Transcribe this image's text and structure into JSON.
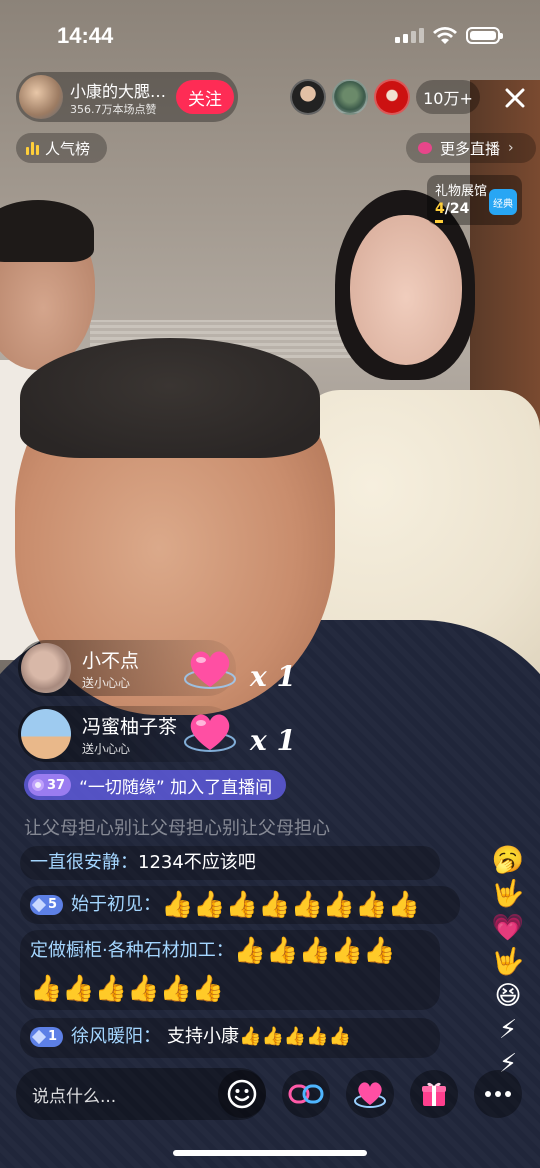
{
  "status_bar": {
    "time": "14:44"
  },
  "anchor": {
    "name": "小康的大腮…",
    "likes": "356.7万本场点赞",
    "follow_label": "关注"
  },
  "viewers": {
    "count_label": "10万+"
  },
  "rank_label": "人气榜",
  "more_live_label": "更多直播",
  "gift_pavilion": {
    "title": "礼物展馆",
    "current": "4",
    "total": "/24",
    "badge": "经典"
  },
  "gift_notifications": [
    {
      "user": "小不点",
      "action": "送小心心",
      "multiplier": "x 1"
    },
    {
      "user": "冯蜜柚子茶",
      "action": "送小心心",
      "multiplier": "x 1"
    }
  ],
  "join_notice": {
    "level": "37",
    "text": "“一切随缘” 加入了直播间"
  },
  "chat": [
    {
      "text": "让父母担心别让父母担心别让父母担心"
    },
    {
      "user": "一直很安静：",
      "message": "1234不应该吧"
    },
    {
      "level": "5",
      "user": "始于初见：",
      "message": "👍👍👍👍👍👍👍👍"
    },
    {
      "user": "定做橱柜·各种石材加工：",
      "message": "👍👍👍👍👍",
      "message2": "👍👍👍👍👍👍"
    },
    {
      "level": "1",
      "user": "徐风暖阳：",
      "message": "支持小康👍👍👍👍👍"
    }
  ],
  "side_emojis": [
    "🥱",
    "🤟",
    "💗",
    "🤟",
    "😆",
    "⚡",
    "⚡"
  ],
  "input": {
    "placeholder": "说点什么..."
  },
  "colors": {
    "follow": "#fe2c55",
    "accent_blue": "#a4d6ff",
    "join_pill": "#5e5bdc"
  }
}
